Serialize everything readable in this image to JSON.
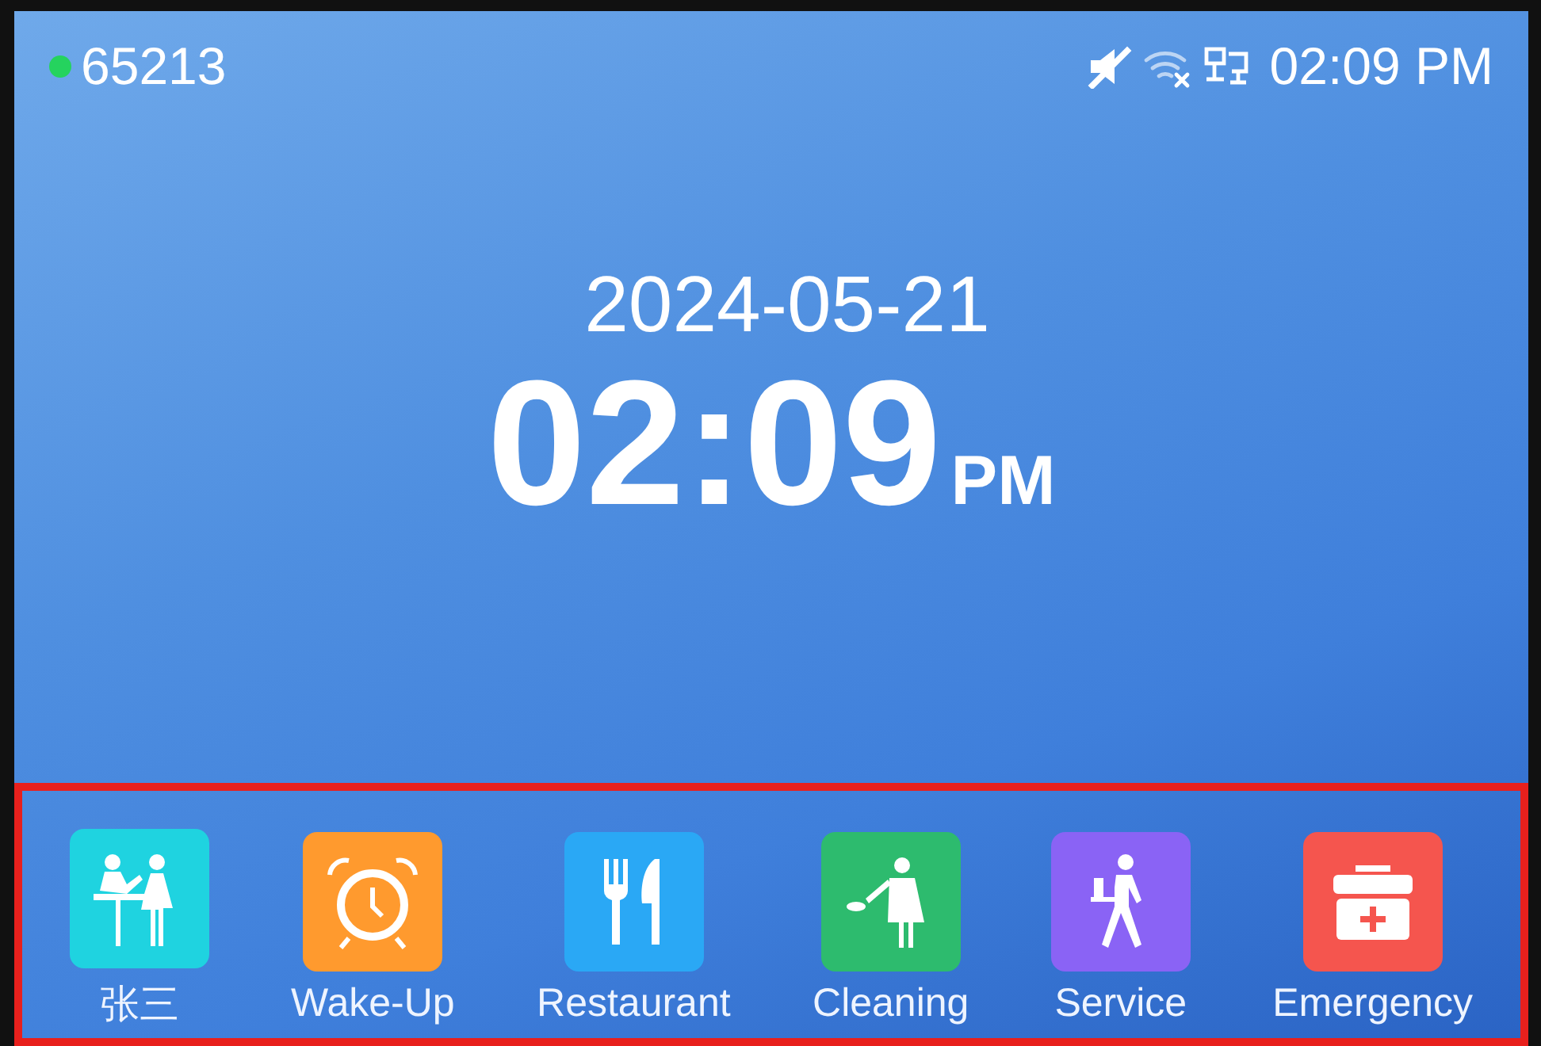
{
  "status_bar": {
    "registered": true,
    "extension": "65213",
    "time": "02:09 PM"
  },
  "clock": {
    "date": "2024-05-21",
    "time": "02:09",
    "meridiem": "PM"
  },
  "dock": {
    "highlighted": true,
    "items": [
      {
        "label": "张三",
        "kind": "reception",
        "color": "#1fd3e0"
      },
      {
        "label": "Wake-Up",
        "kind": "alarm",
        "color": "#ff9a2e"
      },
      {
        "label": "Restaurant",
        "kind": "dining",
        "color": "#2aa8f5"
      },
      {
        "label": "Cleaning",
        "kind": "cleaning",
        "color": "#2dbb6e"
      },
      {
        "label": "Service",
        "kind": "service",
        "color": "#8a63f5"
      },
      {
        "label": "Emergency",
        "kind": "emergency",
        "color": "#f5554e"
      }
    ]
  }
}
